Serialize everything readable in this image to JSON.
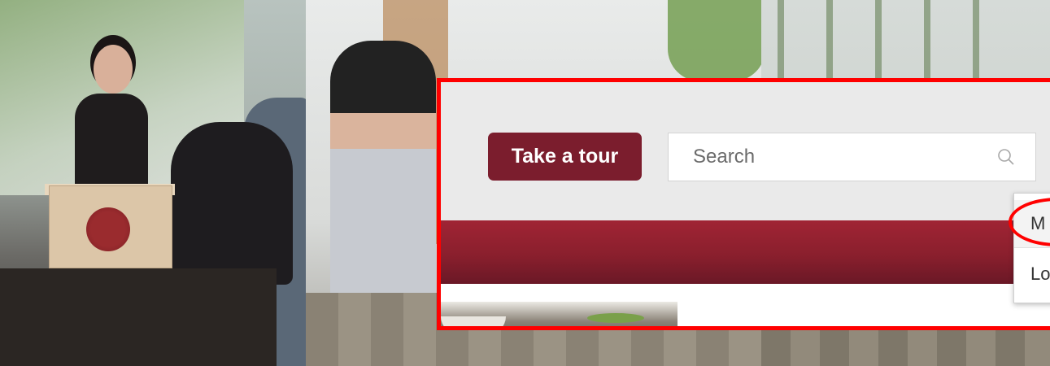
{
  "toolbar": {
    "take_tour_label": "Take a tour"
  },
  "search": {
    "placeholder": "Search",
    "icon": "search-icon"
  },
  "dropdown": {
    "items": [
      {
        "label": "M"
      },
      {
        "label": "Lo"
      }
    ]
  },
  "colors": {
    "brand_maroon": "#7b1d2d",
    "bar_maroon": "#8a1f2d",
    "highlight_red": "#ff0000",
    "header_bg": "#eaeaea"
  }
}
